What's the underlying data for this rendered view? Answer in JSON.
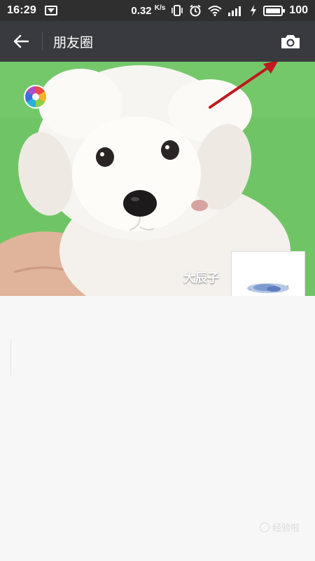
{
  "status_bar": {
    "time": "16:29",
    "speed_value": "0.32",
    "speed_unit": "K/s",
    "battery_percent": "100"
  },
  "nav": {
    "title": "朋友圈",
    "back_icon": "arrow-left-icon",
    "camera_icon": "camera-icon"
  },
  "profile": {
    "nickname": "大辰子"
  },
  "watermark": {
    "text": "经验啦"
  },
  "colors": {
    "navbar_bg": "#393a3f",
    "cover_green": "#6fc565",
    "annotation_arrow": "#c0191f"
  }
}
